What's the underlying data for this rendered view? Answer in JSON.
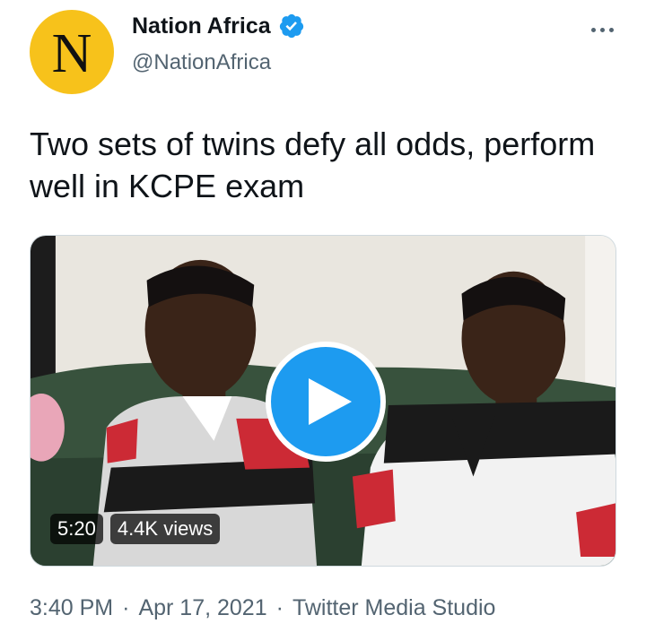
{
  "account": {
    "avatar_letter": "N",
    "display_name": "Nation Africa",
    "handle": "@NationAfrica",
    "verified": true
  },
  "tweet": {
    "text": "Two sets of twins defy all odds, perform well in KCPE exam"
  },
  "media": {
    "duration": "5:20",
    "views": "4.4K views"
  },
  "footer": {
    "time": "3:40 PM",
    "separator1": "·",
    "date": "Apr 17, 2021",
    "separator2": "·",
    "source": "Twitter Media Studio"
  },
  "colors": {
    "avatar_bg": "#f7c21b",
    "accent_blue": "#1d9bf0",
    "secondary_text": "#536471",
    "primary_text": "#0f1419"
  },
  "icons": {
    "verified": "verified-badge-icon",
    "more": "more-options-icon",
    "play": "play-icon"
  }
}
